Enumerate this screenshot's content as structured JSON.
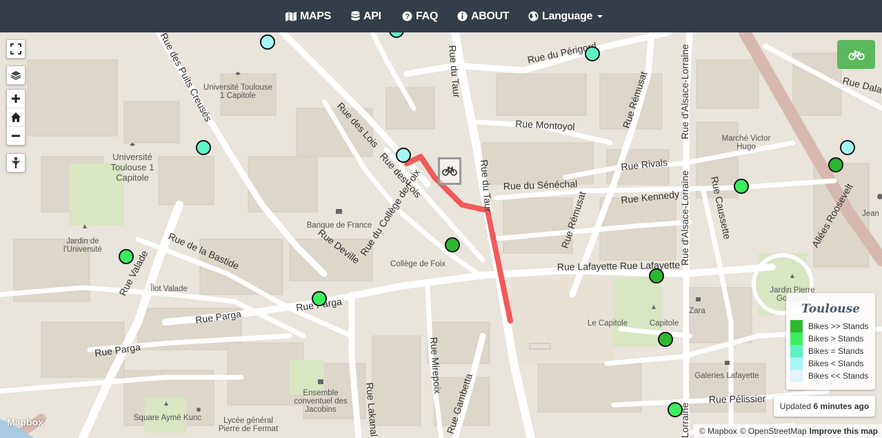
{
  "nav": {
    "maps": "MAPS",
    "api": "API",
    "faq": "FAQ",
    "about": "ABOUT",
    "language": "Language"
  },
  "streets": {
    "puits_creuses": "Rue des Puits Creusés",
    "perigord": "Rue du Périgord",
    "du_taur": "Rue du Taur",
    "montoyol": "Rue Montoyol",
    "remusat": "Rue Rémusat",
    "alsace_lorraine": "Rue d'Alsace-Lorraine",
    "dalay": "Rue Dala",
    "des_lois_1": "Rue des Lois",
    "des_lois_2": "Rue des Lois",
    "college_de_foix": "Rue du Collège de Foix",
    "senechal": "Rue du Sénéchal",
    "rivals": "Rue Rivals",
    "kennedy": "Rue Kennedy",
    "caussette": "Rue Caussette",
    "roosevelt": "Allées Roosevelt",
    "bastide": "Rue de la Bastide",
    "deville": "Rue Deville",
    "valade": "Rue Valade",
    "lafayette": "Rue Lafayette Rue Lafayette",
    "parga_1": "Rue Parga",
    "parga_2": "Rue Parga",
    "parga_3": "Rue Parga",
    "mirepoix": "Rue Mirepoix",
    "lakanal": "Rue Lakanal",
    "gambetta": "Rue Gambetta",
    "pelissier": "Rue Pélissier",
    "alsace_lorraine_2": "Rue d'Alsace-Lorraine",
    "lorraine_bottom": "Lorraine"
  },
  "pois": {
    "univ_small_1": "Université Toulouse",
    "univ_small_2": "1 Capitole",
    "univ_big_1": "Université",
    "univ_big_2": "Toulouse 1",
    "univ_big_3": "Capitole",
    "jardin_univ_1": "Jardin de",
    "jardin_univ_2": "l'Université",
    "ilot_valade": "Îlot Valade",
    "banque_france": "Banque de France",
    "college_foix": "Collège de Foix",
    "marche_1": "Marché Victor",
    "marche_2": "Hugo",
    "jardin_pierre_1": "Jardin Pierre",
    "jardin_pierre_2": "Goudouli",
    "le_capitole": "Le Capitole",
    "capitole": "Capitole",
    "zara": "Zara",
    "galeries": "Galeries Lafayette",
    "ensemble_1": "Ensemble",
    "ensemble_2": "conventuel des",
    "ensemble_3": "Jacobins",
    "square_ayme": "Square Aymé Kunc",
    "lycee_1": "Lycée général",
    "lycee_2": "Pierre de Fermat",
    "jean": "Jean"
  },
  "legend": {
    "title": "Toulouse",
    "items": [
      {
        "label": "Bikes >> Stands",
        "color": "#2db82d"
      },
      {
        "label": "Bikes > Stands",
        "color": "#3ded5f"
      },
      {
        "label": "Bikes = Stands",
        "color": "#5ff2c4"
      },
      {
        "label": "Bikes < Stands",
        "color": "#a6f5f5"
      },
      {
        "label": "Bikes << Stands",
        "color": "#e3f3fb"
      }
    ]
  },
  "updated": {
    "prefix": "Updated",
    "value": "6 minutes ago"
  },
  "attribution": {
    "mapbox": "© Mapbox",
    "osm": "© OpenStreetMap",
    "improve": "Improve this map"
  },
  "logo": "Mapbox",
  "colors": {
    "navbar": "#353d48",
    "route": "#f25a5a",
    "bike_button": "#5cb85c"
  },
  "icons": {
    "fullscreen": "fullscreen-icon",
    "layers": "layers-icon",
    "zoom_in": "plus-icon",
    "home": "home-icon",
    "zoom_out": "minus-icon",
    "locate": "pegman-icon",
    "bike": "bicycle-icon"
  }
}
